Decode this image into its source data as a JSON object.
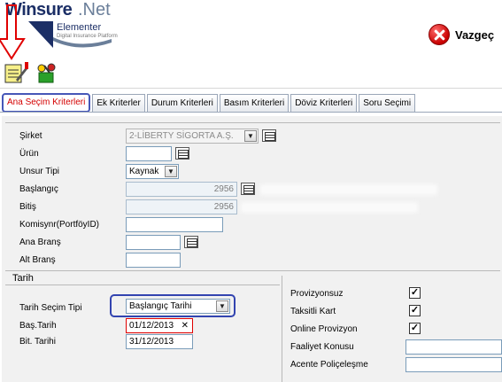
{
  "header": {
    "brand": "Winsure",
    "brand_suffix": ".Net",
    "product": "Elementer",
    "tagline": "Digital Insurance Platform",
    "close_label": "Vazgeç"
  },
  "tabs": [
    {
      "label": "Ana Seçim Kriterleri",
      "active": true
    },
    {
      "label": "Ek Kriterler"
    },
    {
      "label": "Durum Kriterleri"
    },
    {
      "label": "Basım Kriterleri"
    },
    {
      "label": "Döviz Kriterleri"
    },
    {
      "label": "Soru Seçimi"
    }
  ],
  "form": {
    "sirket": {
      "label": "Şirket",
      "value": "2-LİBERTY SİGORTA A.Ş."
    },
    "urun": {
      "label": "Ürün",
      "value": ""
    },
    "unsur_tipi": {
      "label": "Unsur Tipi",
      "value": "Kaynak"
    },
    "baslangic": {
      "label": "Başlangıç",
      "value": "2956"
    },
    "bitis": {
      "label": "Bitiş",
      "value": "2956"
    },
    "komisyoncu": {
      "label": "Komisynr(PortföyID)",
      "value": ""
    },
    "ana_brans": {
      "label": "Ana Branş",
      "value": ""
    },
    "alt_brans": {
      "label": "Alt Branş",
      "value": ""
    }
  },
  "tarih": {
    "section_title": "Tarih",
    "secim_tipi": {
      "label": "Tarih Seçim Tipi",
      "value": "Başlangıç Tarihi"
    },
    "bas_tarih": {
      "label": "Baş.Tarih",
      "value": "01/12/2013",
      "clear": "✕"
    },
    "bit_tarih": {
      "label": "Bit. Tarihi",
      "value": "31/12/2013"
    }
  },
  "options": {
    "provizyonsuz": {
      "label": "Provizyonsuz",
      "checked": true,
      "mark": "✓"
    },
    "taksitli_kart": {
      "label": "Taksitli Kart",
      "checked": true,
      "mark": "✓"
    },
    "online_provizyon": {
      "label": "Online Provizyon",
      "checked": true,
      "mark": "✓"
    },
    "faaliyet_konusu": {
      "label": "Faaliyet Konusu",
      "value": ""
    },
    "acente_policelesme": {
      "label": "Acente Poliçeleşme",
      "value": ""
    }
  },
  "colors": {
    "accent": "#3344b0",
    "active_tab_text": "#d40000",
    "annotation": "#e00000"
  }
}
